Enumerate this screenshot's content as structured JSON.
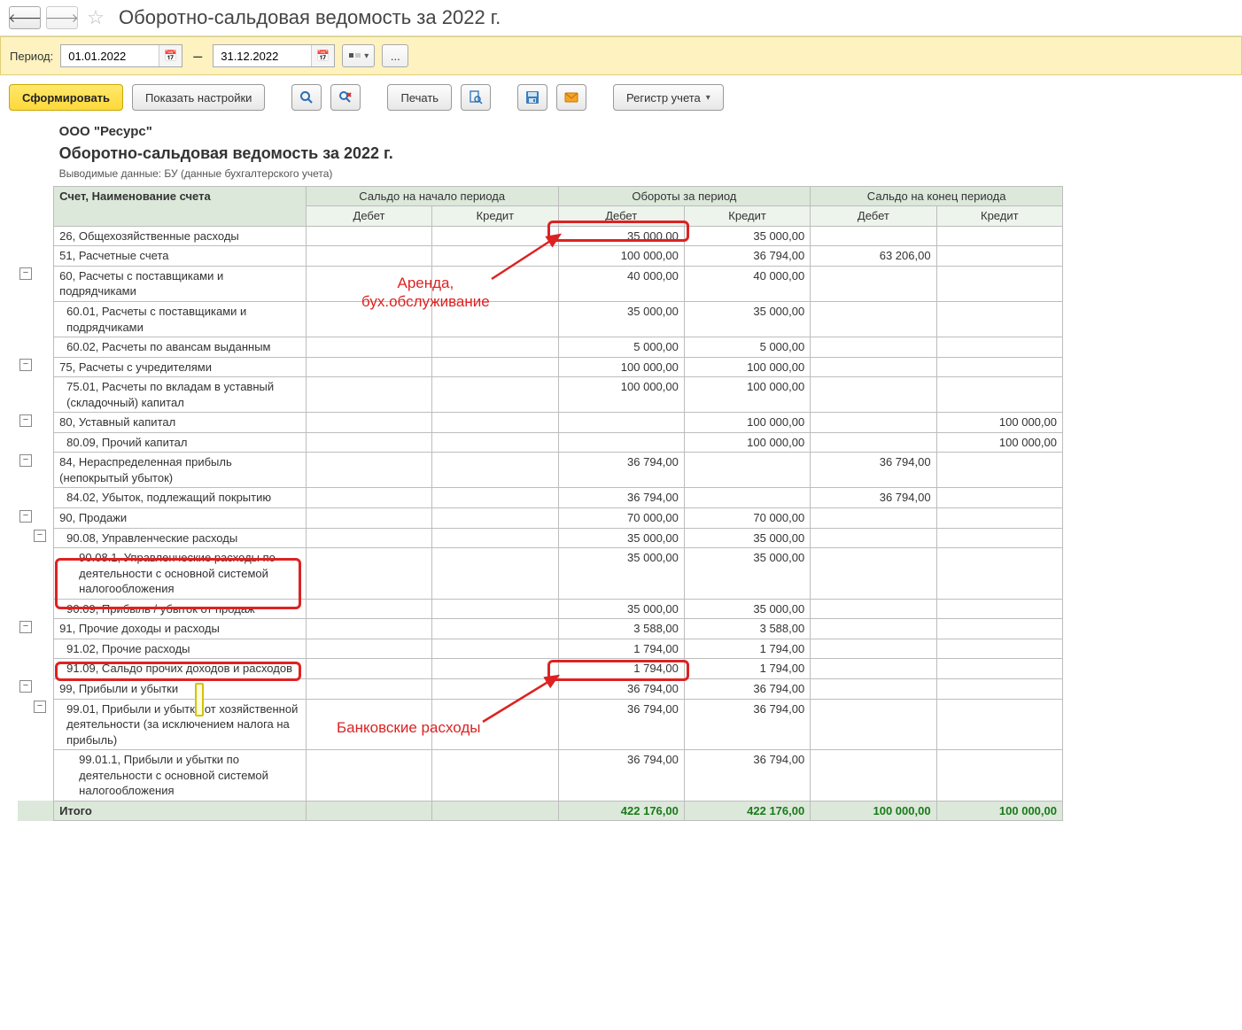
{
  "page": {
    "title": "Оборотно-сальдовая ведомость за 2022 г."
  },
  "period": {
    "label": "Период:",
    "from": "01.01.2022",
    "to": "31.12.2022",
    "ellipsis": "..."
  },
  "toolbar": {
    "generate": "Сформировать",
    "settings": "Показать настройки",
    "print": "Печать",
    "register": "Регистр учета"
  },
  "header": {
    "company": "ООО \"Ресурс\"",
    "report_title": "Оборотно-сальдовая ведомость за 2022 г.",
    "subtitle": "Выводимые данные: БУ (данные бухгалтерского учета)"
  },
  "columns": {
    "acct": "Счет, Наименование счета",
    "open": "Сальдо на начало периода",
    "turn": "Обороты за период",
    "close": "Сальдо на конец периода",
    "debit": "Дебет",
    "credit": "Кредит"
  },
  "rows": [
    {
      "name": "26, Общехозяйственные расходы",
      "lvl": 0,
      "od": "35 000,00",
      "oc": "35 000,00"
    },
    {
      "name": "51, Расчетные счета",
      "lvl": 0,
      "od": "100 000,00",
      "oc": "36 794,00",
      "ed": "63 206,00"
    },
    {
      "name": "60, Расчеты с поставщиками и подрядчиками",
      "lvl": 0,
      "od": "40 000,00",
      "oc": "40 000,00",
      "tree": "minus"
    },
    {
      "name": "60.01, Расчеты с поставщиками и подрядчиками",
      "lvl": 1,
      "od": "35 000,00",
      "oc": "35 000,00"
    },
    {
      "name": "60.02, Расчеты по авансам выданным",
      "lvl": 1,
      "od": "5 000,00",
      "oc": "5 000,00"
    },
    {
      "name": "75, Расчеты с учредителями",
      "lvl": 0,
      "od": "100 000,00",
      "oc": "100 000,00",
      "tree": "minus"
    },
    {
      "name": "75.01, Расчеты по вкладам в уставный (складочный) капитал",
      "lvl": 1,
      "od": "100 000,00",
      "oc": "100 000,00"
    },
    {
      "name": "80, Уставный капитал",
      "lvl": 0,
      "oc": "100 000,00",
      "ec": "100 000,00",
      "tree": "minus"
    },
    {
      "name": "80.09, Прочий капитал",
      "lvl": 1,
      "oc": "100 000,00",
      "ec": "100 000,00"
    },
    {
      "name": "84, Нераспределенная прибыль (непокрытый убыток)",
      "lvl": 0,
      "od": "36 794,00",
      "ed": "36 794,00",
      "tree": "minus"
    },
    {
      "name": "84.02, Убыток, подлежащий покрытию",
      "lvl": 1,
      "od": "36 794,00",
      "ed": "36 794,00"
    },
    {
      "name": "90, Продажи",
      "lvl": 0,
      "od": "70 000,00",
      "oc": "70 000,00",
      "tree": "minus"
    },
    {
      "name": "90.08, Управленческие расходы",
      "lvl": 1,
      "od": "35 000,00",
      "oc": "35 000,00",
      "tree": "minus_sub"
    },
    {
      "name": "90.08.1, Управленческие расходы по деятельности с основной системой налогообложения",
      "lvl": 2,
      "od": "35 000,00",
      "oc": "35 000,00"
    },
    {
      "name": "90.09, Прибыль / убыток от продаж",
      "lvl": 1,
      "od": "35 000,00",
      "oc": "35 000,00"
    },
    {
      "name": "91, Прочие доходы и расходы",
      "lvl": 0,
      "od": "3 588,00",
      "oc": "3 588,00",
      "tree": "minus"
    },
    {
      "name": "91.02, Прочие расходы",
      "lvl": 1,
      "od": "1 794,00",
      "oc": "1 794,00"
    },
    {
      "name": "91.09, Сальдо прочих доходов и расходов",
      "lvl": 1,
      "od": "1 794,00",
      "oc": "1 794,00"
    },
    {
      "name": "99, Прибыли и убытки",
      "lvl": 0,
      "od": "36 794,00",
      "oc": "36 794,00",
      "tree": "minus"
    },
    {
      "name": "99.01, Прибыли и убытки от хозяйственной деятельности (за исключением налога на прибыль)",
      "lvl": 1,
      "od": "36 794,00",
      "oc": "36 794,00",
      "tree": "minus_sub"
    },
    {
      "name": "99.01.1, Прибыли и убытки по деятельности с основной системой налогообложения",
      "lvl": 2,
      "od": "36 794,00",
      "oc": "36 794,00"
    }
  ],
  "total": {
    "label": "Итого",
    "od": "422 176,00",
    "oc": "422 176,00",
    "ed": "100 000,00",
    "ec": "100 000,00"
  },
  "annotations": {
    "a1": "Аренда,\nбух.обслуживание",
    "a2": "Банковские расходы"
  }
}
